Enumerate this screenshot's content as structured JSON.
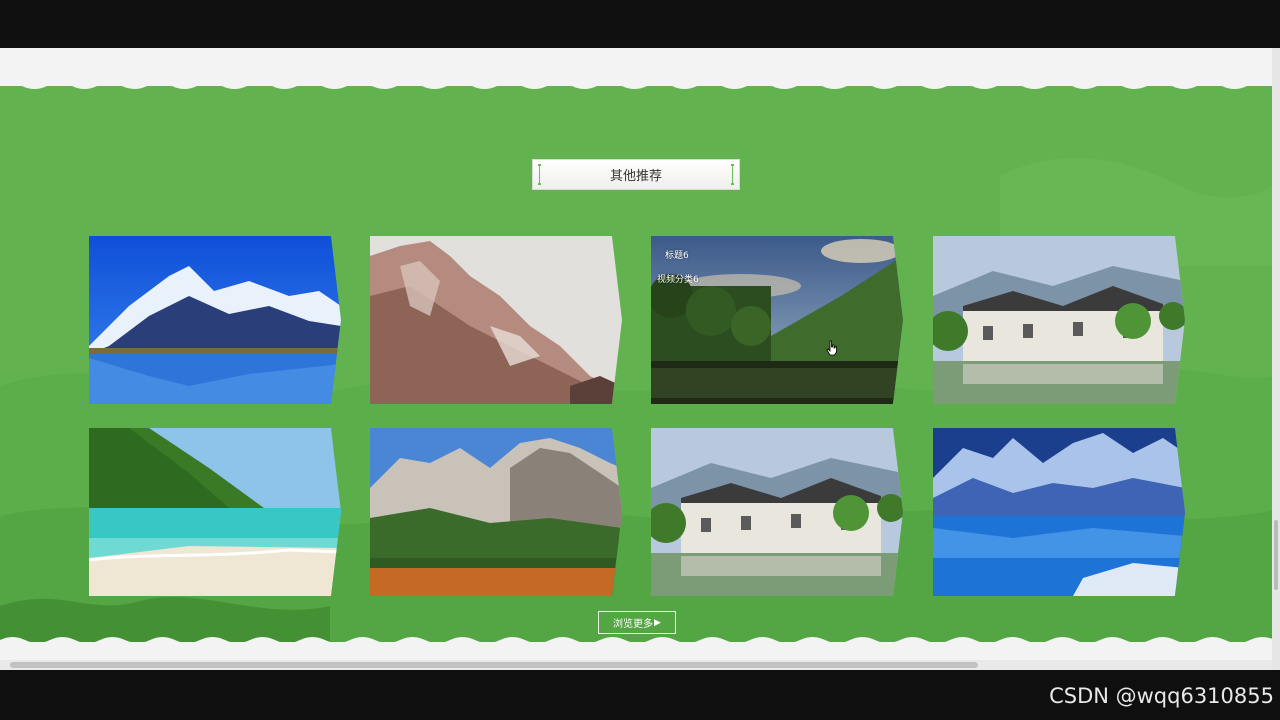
{
  "section": {
    "title": "其他推荐",
    "more_label": "浏览更多",
    "more_arrow": "▶"
  },
  "cards": [
    {
      "scene": "snow-mountain-lake",
      "title": "",
      "category": ""
    },
    {
      "scene": "rocky-cliff",
      "title": "",
      "category": ""
    },
    {
      "scene": "forest-lake",
      "title": "标题6",
      "category": "视频分类6"
    },
    {
      "scene": "ancient-village",
      "title": "",
      "category": ""
    },
    {
      "scene": "tropical-beach",
      "title": "",
      "category": ""
    },
    {
      "scene": "dolomite-forest",
      "title": "",
      "category": ""
    },
    {
      "scene": "ancient-village",
      "title": "",
      "category": ""
    },
    {
      "scene": "glacier-lake",
      "title": "",
      "category": ""
    }
  ],
  "watermark": "CSDN @wqq6310855",
  "colors": {
    "section_bg": "#62b34f",
    "page_bg": "#f3f3f3",
    "frame": "#0f0f10"
  },
  "icons": {
    "cursor": "hand-pointer-icon",
    "more_arrow": "play-arrow-icon"
  }
}
